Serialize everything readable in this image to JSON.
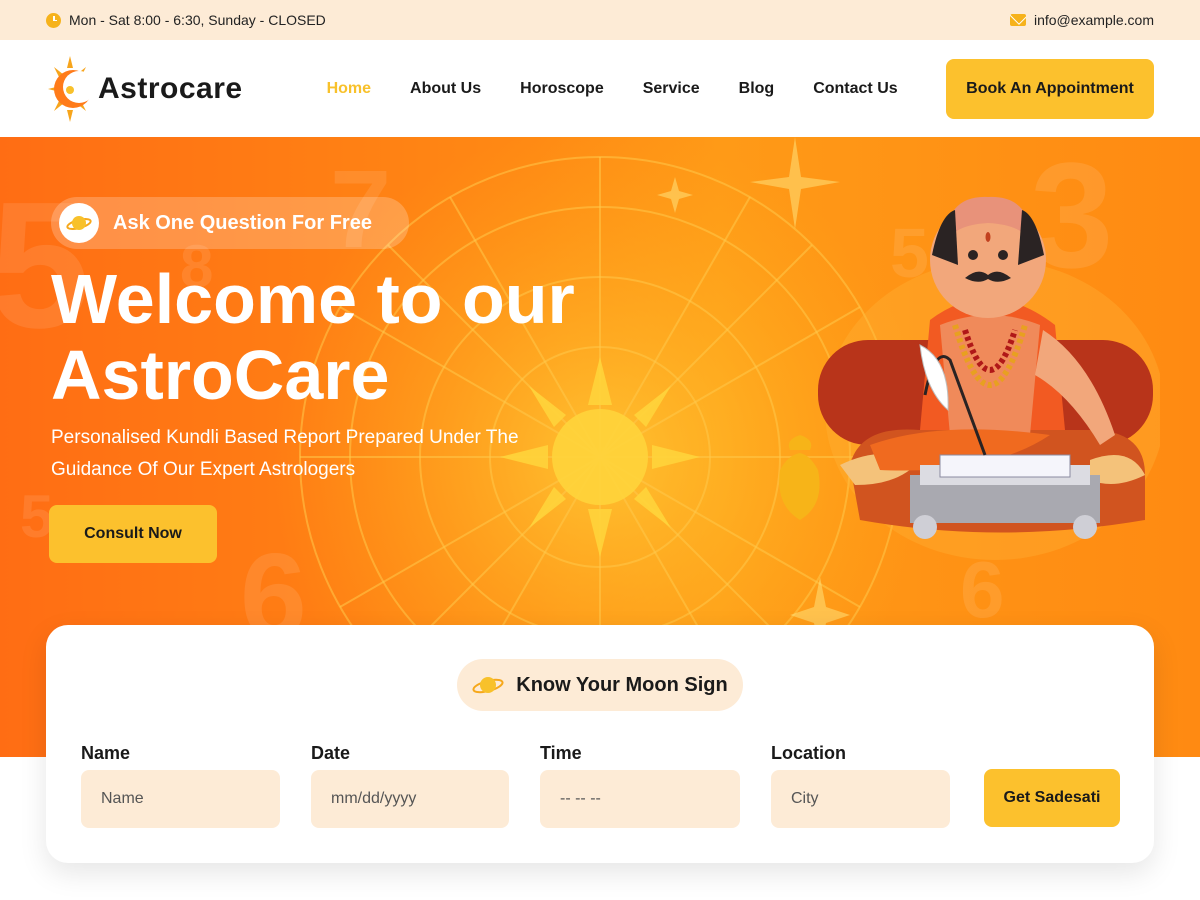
{
  "topbar": {
    "hours": "Mon - Sat 8:00 - 6:30, Sunday - CLOSED",
    "email": "info@example.com"
  },
  "header": {
    "brand": "Astrocare",
    "nav": [
      "Home",
      "About Us",
      "Horoscope",
      "Service",
      "Blog",
      "Contact Us"
    ],
    "active_nav": "Home",
    "book_label": "Book An Appointment"
  },
  "hero": {
    "badge": "Ask One Question For Free",
    "title_line1": "Welcome to our",
    "title_line2": "AstroCare",
    "subtitle_line1": "Personalised Kundli Based Report Prepared Under The",
    "subtitle_line2": "Guidance Of Our Expert Astrologers",
    "cta_label": "Consult Now"
  },
  "moon_sign": {
    "heading": "Know Your Moon Sign",
    "fields": {
      "name": {
        "label": "Name",
        "placeholder": "Name"
      },
      "date": {
        "label": "Date",
        "placeholder": "mm/dd/yyyy"
      },
      "time": {
        "label": "Time",
        "placeholder": "-- -- --"
      },
      "location": {
        "label": "Location",
        "placeholder": "City"
      }
    },
    "submit_label": "Get Sadesati"
  },
  "colors": {
    "accent": "#fcc12d",
    "hero_orange": "#ff7a14",
    "topbar_bg": "#fdebd6"
  },
  "icons": [
    "clock-icon",
    "mail-icon",
    "sun-moon-logo-icon",
    "planet-icon"
  ]
}
